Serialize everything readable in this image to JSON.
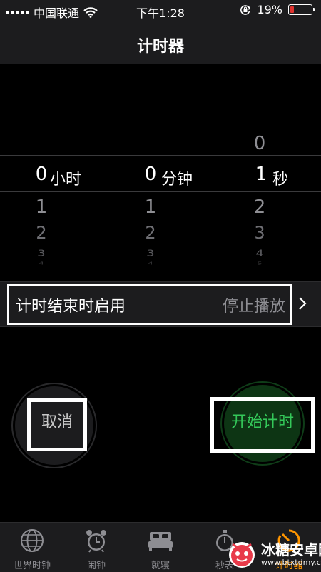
{
  "status_bar": {
    "carrier": "中国联通",
    "time": "下午1:28",
    "battery_percent": "19%",
    "battery_level": 0.19
  },
  "nav": {
    "title": "计时器"
  },
  "picker": {
    "hours": {
      "value": "0",
      "unit": "小时",
      "below": [
        "1",
        "2",
        "3",
        "4"
      ]
    },
    "minutes": {
      "value": "0",
      "unit": "分钟",
      "below": [
        "1",
        "2",
        "3",
        "4"
      ]
    },
    "seconds": {
      "above": [
        "0"
      ],
      "value": "1",
      "unit": "秒",
      "below": [
        "2",
        "3",
        "4",
        "5"
      ]
    }
  },
  "on_end": {
    "label": "计时结束时启用",
    "value": "停止播放"
  },
  "buttons": {
    "cancel": "取消",
    "start": "开始计时"
  },
  "tabs": [
    {
      "label": "世界时钟",
      "icon": "globe-icon"
    },
    {
      "label": "闹钟",
      "icon": "alarm-clock-icon"
    },
    {
      "label": "就寝",
      "icon": "bed-icon"
    },
    {
      "label": "秒表",
      "icon": "stopwatch-icon"
    },
    {
      "label": "计时器",
      "icon": "timer-icon",
      "active": true
    }
  ],
  "watermark": {
    "text": "冰糖安卓网",
    "url": "www.btxtdmy.com"
  },
  "colors": {
    "accent_green": "#34c759",
    "tab_active": "#ff9500",
    "battery_low": "#e0332f"
  }
}
